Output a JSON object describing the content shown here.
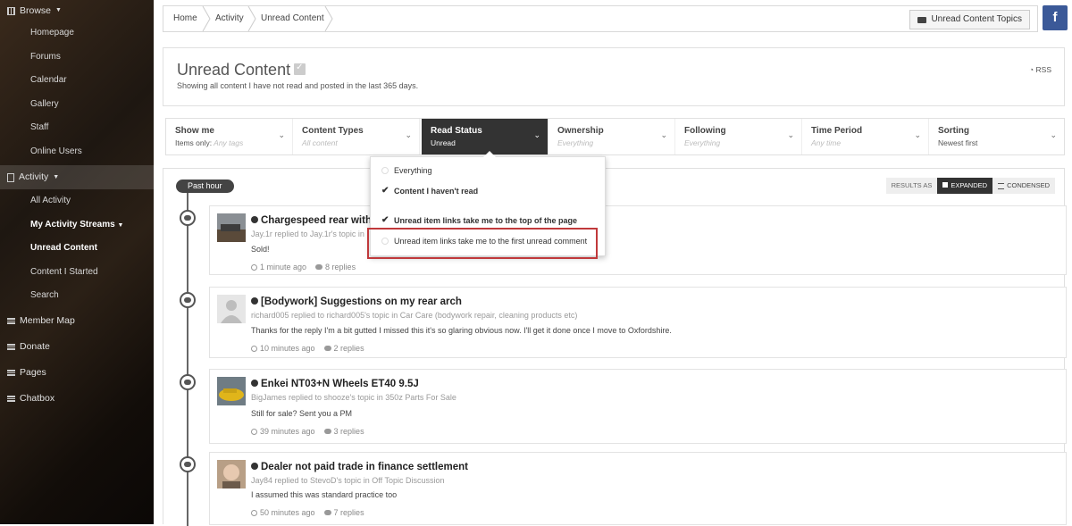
{
  "sidebar": {
    "browse": "Browse",
    "browse_items": [
      "Homepage",
      "Forums",
      "Calendar",
      "Gallery",
      "Staff",
      "Online Users"
    ],
    "activity": "Activity",
    "activity_items": [
      "All Activity",
      "My Activity Streams",
      "Unread Content",
      "Content I Started",
      "Search"
    ],
    "other_items": [
      "Member Map",
      "Donate",
      "Pages",
      "Chatbox"
    ]
  },
  "breadcrumb": [
    "Home",
    "Activity",
    "Unread Content"
  ],
  "topics_button": "Unread Content Topics",
  "facebook": "f",
  "header": {
    "title": "Unread Content",
    "description": "Showing all content I have not read and posted in the last 365 days.",
    "rss": "RSS"
  },
  "filters": [
    {
      "title": "Show me",
      "prefix": "Items only:",
      "value": "Any tags"
    },
    {
      "title": "Content Types",
      "value": "All content"
    },
    {
      "title": "Read Status",
      "value": "Unread"
    },
    {
      "title": "Ownership",
      "value": "Everything"
    },
    {
      "title": "Following",
      "value": "Everything"
    },
    {
      "title": "Time Period",
      "value": "Any time"
    },
    {
      "title": "Sorting",
      "value": "Newest first"
    }
  ],
  "dropdown": {
    "items": [
      "Everything",
      "Content I haven't read",
      "Unread item links take me to the top of the page",
      "Unread item links take me to the first unread comment"
    ]
  },
  "results": {
    "section": "Past hour",
    "results_as": "RESULTS AS",
    "expanded": "EXPANDED",
    "condensed": "CONDENSED"
  },
  "posts": [
    {
      "title": "Chargespeed rear with",
      "meta": "Jay.1r replied to Jay.1r's topic in",
      "snippet": "Sold!",
      "time": "1 minute ago",
      "replies": "8 replies"
    },
    {
      "title": "[Bodywork] Suggestions on my rear arch",
      "meta": "richard005 replied to richard005's topic in Car Care (bodywork repair, cleaning products etc)",
      "snippet": "Thanks for the reply I'm a bit gutted I missed this it's so glaring obvious now. I'll get it done once I move to Oxfordshire.",
      "time": "10 minutes ago",
      "replies": "2 replies"
    },
    {
      "title": "Enkei NT03+N Wheels ET40 9.5J",
      "meta": "BigJames replied to shooze's topic in 350z Parts For Sale",
      "snippet": "Still for sale? Sent you a PM",
      "time": "39 minutes ago",
      "replies": "3 replies"
    },
    {
      "title": "Dealer not paid trade in finance settlement",
      "meta": "Jay84 replied to StevoD's topic in Off Topic Discussion",
      "snippet": "I assumed this was standard practice too",
      "time": "50 minutes ago",
      "replies": "7 replies"
    }
  ]
}
